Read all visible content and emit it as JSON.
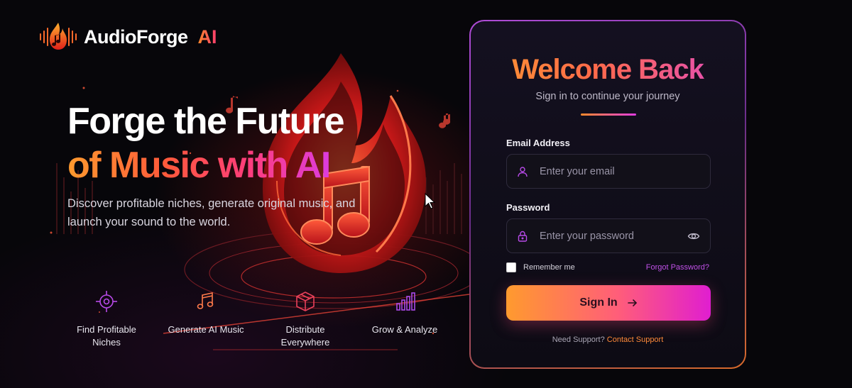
{
  "brand": {
    "name": "AudioForge",
    "ai": "AI",
    "icon": "flame-music-icon"
  },
  "hero": {
    "line1": "Forge the Future",
    "line2": "of Music with AI",
    "description": "Discover profitable niches, generate original music, and launch your sound to the world."
  },
  "features": [
    {
      "label": "Find Profitable Niches",
      "icon": "target-icon"
    },
    {
      "label": "Generate AI Music",
      "icon": "music-note-icon"
    },
    {
      "label": "Distribute Everywhere",
      "icon": "box-icon"
    },
    {
      "label": "Grow & Analyze",
      "icon": "bar-chart-icon"
    }
  ],
  "login": {
    "title": "Welcome Back",
    "subtitle": "Sign in to continue your journey",
    "email_label": "Email Address",
    "email_placeholder": "Enter your email",
    "email_value": "",
    "password_label": "Password",
    "password_placeholder": "Enter your password",
    "password_value": "",
    "remember_label": "Remember me",
    "remember_checked": false,
    "forgot_label": "Forgot Password?",
    "signin_label": "Sign In",
    "support_text": "Need Support?",
    "support_link": "Contact Support"
  },
  "colors": {
    "accent_orange": "#ff9a2e",
    "accent_pink": "#ff3d7a",
    "accent_purple": "#d63cf0",
    "background": "#07060a"
  }
}
